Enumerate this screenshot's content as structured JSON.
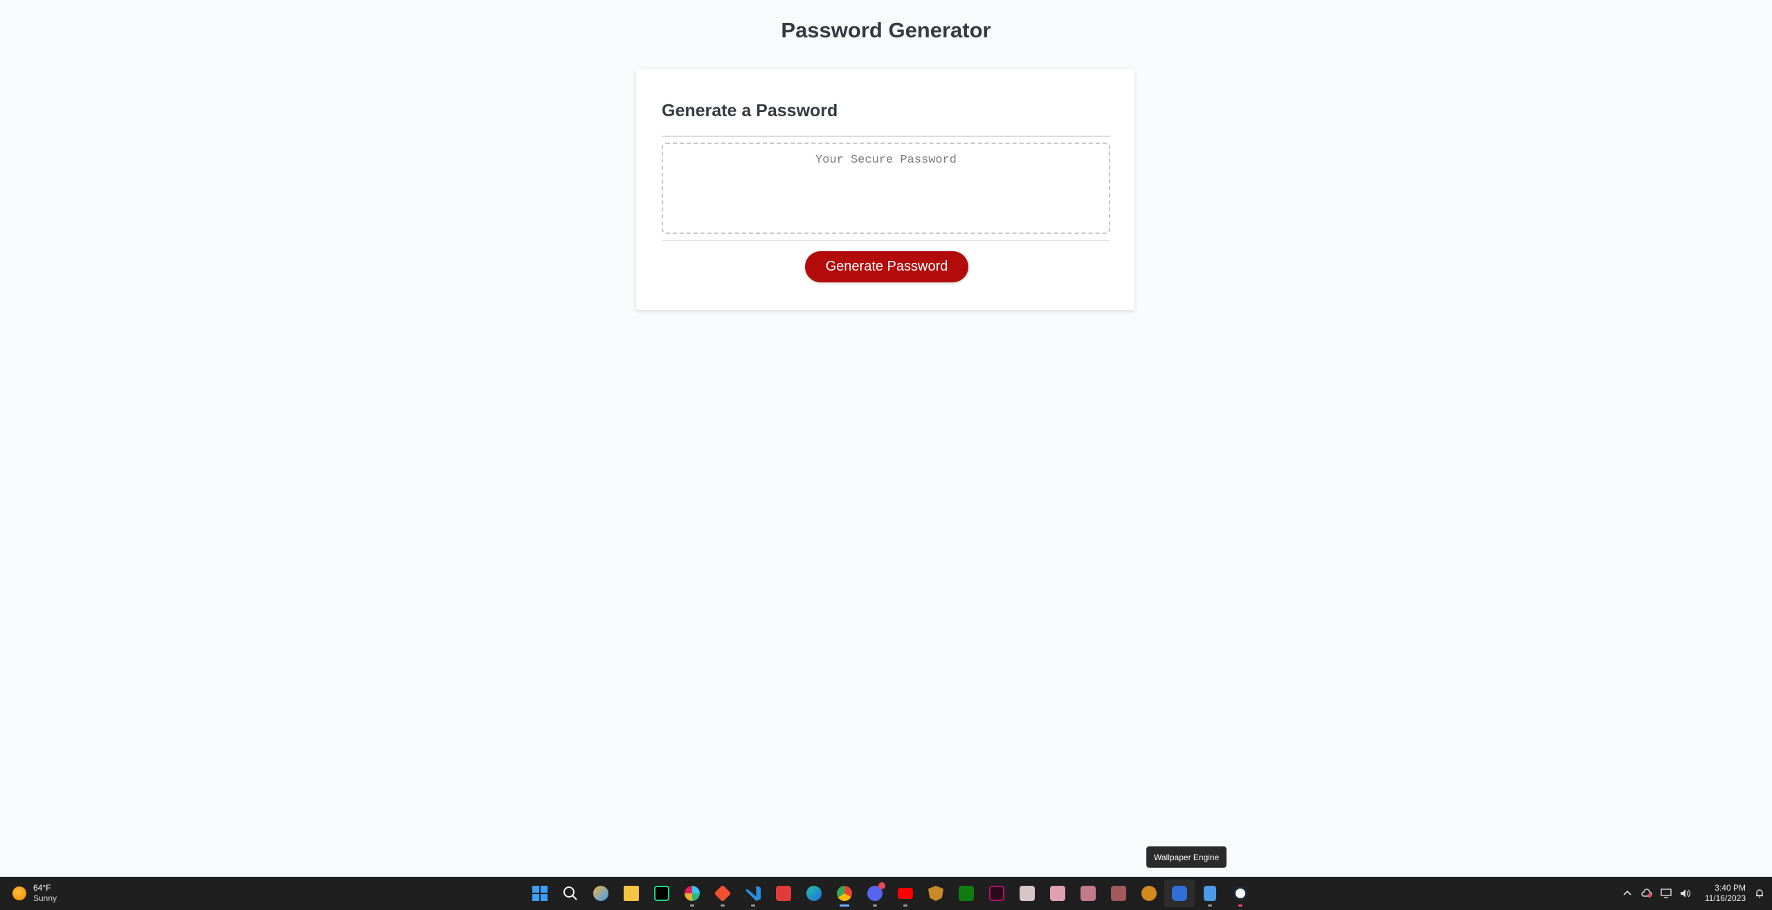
{
  "page": {
    "title": "Password Generator"
  },
  "card": {
    "header": "Generate a Password",
    "password_placeholder": "Your Secure Password",
    "password_value": "",
    "generate_label": "Generate Password"
  },
  "colors": {
    "accent": "#b30b0b",
    "background": "#f9fafb",
    "text": "#343a40"
  },
  "tooltip": {
    "text": "Wallpaper Engine"
  },
  "taskbar": {
    "weather": {
      "icon": "sun-icon",
      "temp": "64°F",
      "condition": "Sunny"
    },
    "apps": [
      {
        "name": "start-icon",
        "color": "#3aa0ff"
      },
      {
        "name": "search-icon",
        "color": "#ffffff"
      },
      {
        "name": "copilot-icon",
        "color": "#f2b13a"
      },
      {
        "name": "file-explorer-icon",
        "color": "#f5c542"
      },
      {
        "name": "pycharm-icon",
        "color": "#21d789"
      },
      {
        "name": "slack-icon",
        "color": "#e01e5a"
      },
      {
        "name": "git-icon",
        "color": "#f05032"
      },
      {
        "name": "vscode-icon",
        "color": "#2a8fe0"
      },
      {
        "name": "flash-app-icon",
        "color": "#e03a3a"
      },
      {
        "name": "edge-icon",
        "color": "#2bbca5"
      },
      {
        "name": "chrome-icon",
        "color": "#f0c020"
      },
      {
        "name": "discord-icon",
        "color": "#5865f2"
      },
      {
        "name": "youtube-icon",
        "color": "#ff0000"
      },
      {
        "name": "game-launcher-icon",
        "color": "#c98a2a"
      },
      {
        "name": "xbox-icon",
        "color": "#107c10"
      },
      {
        "name": "vegas-icon",
        "color": "#b0126a"
      },
      {
        "name": "anime-app-icon-1",
        "color": "#d8c6c6"
      },
      {
        "name": "anime-app-icon-2",
        "color": "#e0a0b0"
      },
      {
        "name": "anime-app-icon-3",
        "color": "#c07a8a"
      },
      {
        "name": "anime-app-icon-4",
        "color": "#a05a5a"
      },
      {
        "name": "game-app-icon",
        "color": "#d08a20"
      },
      {
        "name": "wallpaper-engine-icon",
        "color": "#2f6fd6"
      },
      {
        "name": "notepad-icon",
        "color": "#4a9ae8"
      },
      {
        "name": "steam-icon",
        "color": "#1b2838"
      }
    ],
    "clock": {
      "time": "3:40 PM",
      "date": "11/16/2023"
    }
  }
}
